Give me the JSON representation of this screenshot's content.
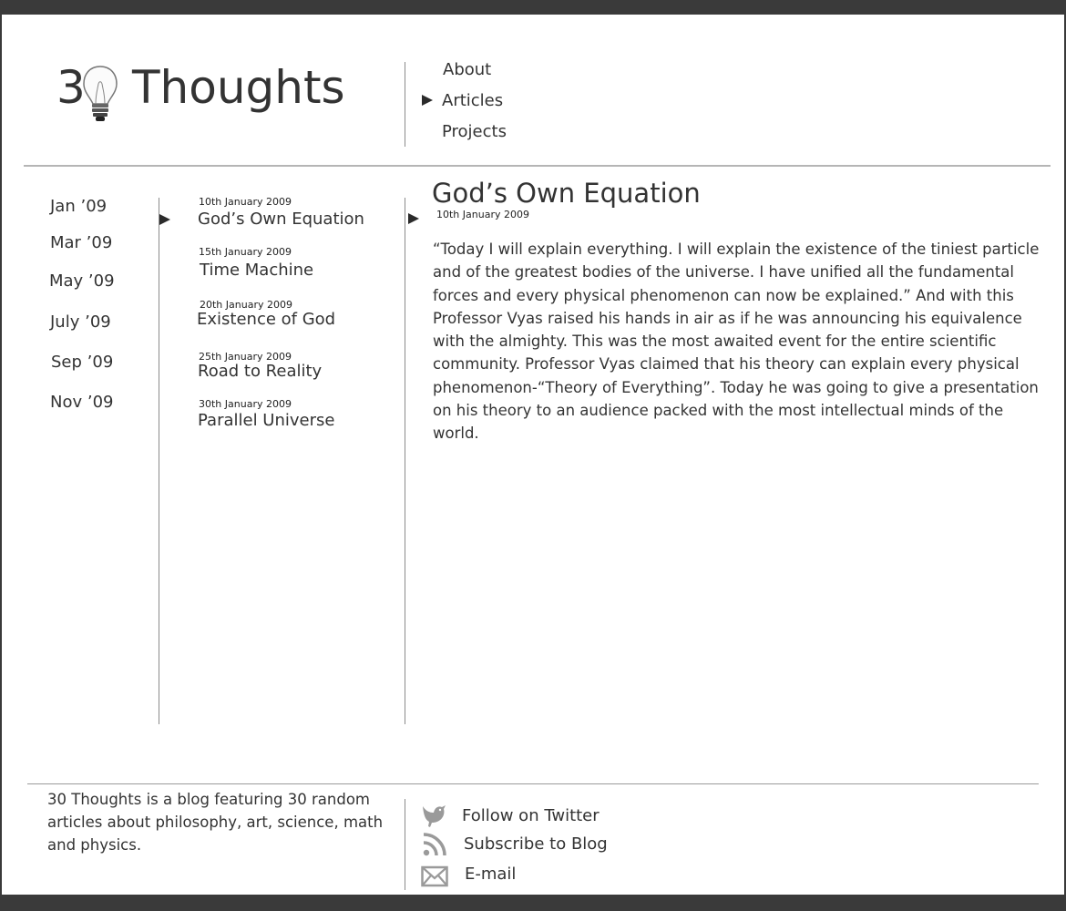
{
  "site": {
    "logo_number": "3",
    "logo_word": "Thoughts"
  },
  "nav": {
    "items": [
      {
        "label": "About"
      },
      {
        "label": "Articles",
        "active": true
      },
      {
        "label": "Projects"
      }
    ]
  },
  "months": [
    "Jan ’09",
    "Mar ’09",
    "May ’09",
    "July ’09",
    "Sep ’09",
    "Nov ’09"
  ],
  "articles": [
    {
      "date": "10th January 2009",
      "title": "God’s Own Equation",
      "selected": true
    },
    {
      "date": "15th January 2009",
      "title": "Time Machine"
    },
    {
      "date": "20th January 2009",
      "title": "Existence of God"
    },
    {
      "date": "25th January 2009",
      "title": "Road to Reality"
    },
    {
      "date": "30th January 2009",
      "title": "Parallel Universe"
    }
  ],
  "article": {
    "title": "God’s Own Equation",
    "date": "10th January 2009",
    "body": "“Today I will explain everything. I will explain the existence of the tiniest particle and of the greatest bodies of the universe. I have unified all the fundamental forces and every physical phenomenon can now be explained.” And with this Professor Vyas raised his hands in air as if he was announcing his equivalence with the almighty. This was the most awaited event for the entire scientific community. Professor Vyas  claimed that his theory can explain every physical phenomenon-“Theory of Everything”. Today he was going to give a presentation on his theory to an audience packed with the most intellectual minds of the world."
  },
  "footer": {
    "about": "30 Thoughts is a blog featuring 30 random articles about philosophy, art, science, math and physics.",
    "links": [
      {
        "label": "Follow on Twitter",
        "icon": "twitter-bird-icon"
      },
      {
        "label": "Subscribe to Blog",
        "icon": "rss-icon"
      },
      {
        "label": "E-mail",
        "icon": "envelope-icon"
      }
    ]
  },
  "colors": {
    "frame": "#3a3a3a",
    "text": "#333333",
    "rule": "#b5b5b5",
    "icon_gray": "#9a9a9a"
  }
}
